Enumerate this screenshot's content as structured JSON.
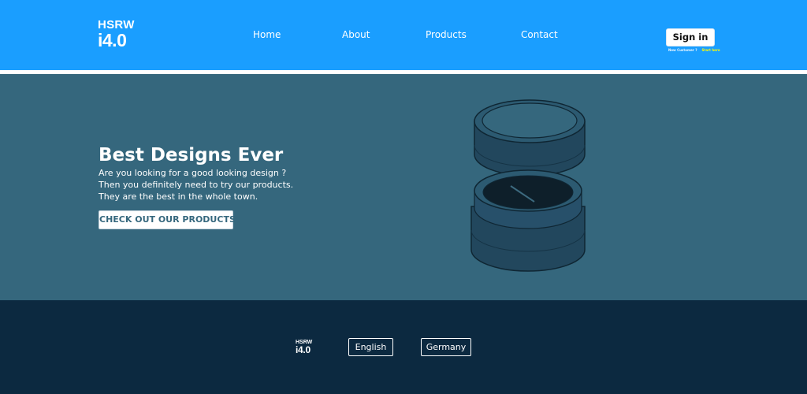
{
  "header": {
    "logo_top": "HSRW",
    "logo_bottom": "i4.0",
    "nav": [
      "Home",
      "About",
      "Products",
      "Contact"
    ],
    "signin_label": "Sign in",
    "new_customer_text": "New Customer ?",
    "start_here_text": "Start here"
  },
  "hero": {
    "title": "Best Designs Ever",
    "lines": [
      "Are you looking for a good looking design ?",
      "Then you definitely need to try our products.",
      "They are the best in the whole town."
    ],
    "cta_label": "CHECK OUT OUR PRODUCTS",
    "product_image": "cylindrical-box-with-lid"
  },
  "footer": {
    "logo_top": "HSRW",
    "logo_bottom": "i4.0",
    "languages": [
      "English",
      "Germany"
    ]
  },
  "colors": {
    "header": "#1a9eff",
    "hero": "#35677d",
    "footer": "#0c2940",
    "accent_yellow": "#fffb00"
  }
}
